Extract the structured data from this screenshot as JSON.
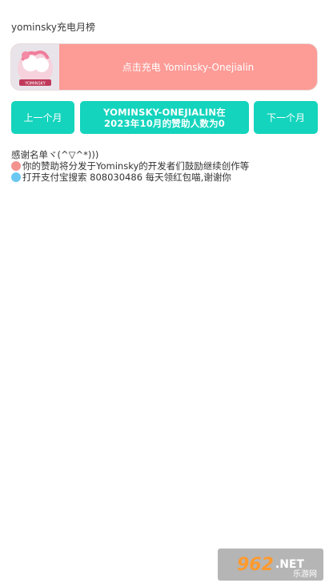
{
  "header": {
    "title": "yominsky充电月榜"
  },
  "charge_card": {
    "text": "点击充电 Yominsky-Onejialin",
    "avatar_caption": "YOMINSKY"
  },
  "nav": {
    "prev_label": "上一个月",
    "summary_line1": "YOMINSKY-ONEJIALIN在",
    "summary_line2": "2023年10月的赞助人数为0",
    "next_label": "下一个月"
  },
  "thanks": {
    "heading": "感谢名单ヾ(^▽^*)))",
    "line1": "你的赞助将分发于Yominsky的开发者们鼓励继续创作等",
    "line2": "打开支付宝搜索 808030486 每天领红包喵,谢谢你"
  },
  "watermark": {
    "brand": "962",
    "suffix": ".NET",
    "sub": "乐游网"
  },
  "colors": {
    "accent": "#14d4bd",
    "card": "#fd9b96",
    "dot_pink": "#f39390",
    "dot_blue": "#6cc8f2"
  }
}
